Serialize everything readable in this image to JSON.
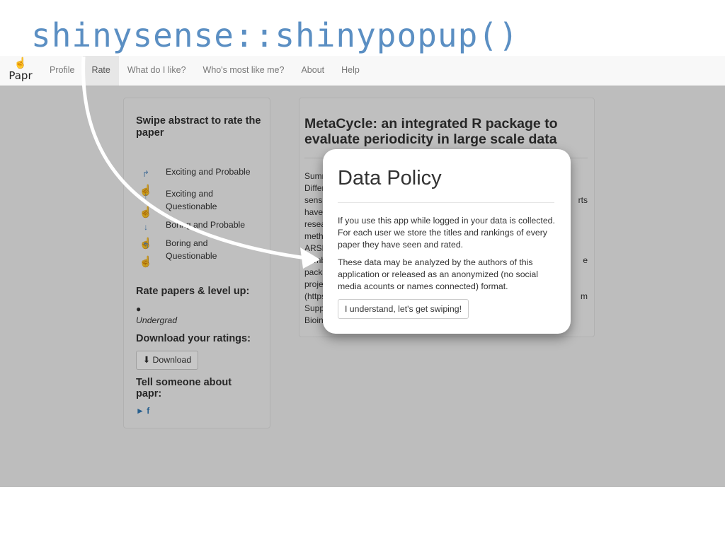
{
  "slide_title": "shinysense::shinypopup()",
  "brand": {
    "icon": "pointing-hand-icon",
    "name": "Papr"
  },
  "nav": {
    "items": [
      {
        "label": "Profile",
        "active": false
      },
      {
        "label": "Rate",
        "active": true
      },
      {
        "label": "What do I like?",
        "active": false
      },
      {
        "label": "Who's most like me?",
        "active": false
      },
      {
        "label": "About",
        "active": false
      },
      {
        "label": "Help",
        "active": false
      }
    ]
  },
  "sidebar": {
    "heading": "Swipe abstract to rate the paper",
    "legend": [
      {
        "icon": "swipe-right-icon",
        "label": "Exciting and Probable"
      },
      {
        "icon": "swipe-up-icon",
        "label": "Exciting and Questionable"
      },
      {
        "icon": "swipe-down-icon",
        "label": "Boring and Probable"
      },
      {
        "icon": "swipe-left-icon",
        "label": "Boring and Questionable"
      }
    ],
    "level_heading": "Rate papers & level up:",
    "level_icon": "user-icon",
    "level": "Undergrad",
    "download_heading": "Download your ratings:",
    "download_button": "Download",
    "tell_heading": "Tell someone about papr:",
    "social_icons": [
      "twitter-icon",
      "facebook-icon"
    ]
  },
  "paper": {
    "title": "MetaCycle: an integrated R package to evaluate periodicity in large scale data",
    "abstract_lines": [
      {
        "left": "Summ",
        "right": ""
      },
      {
        "left": "Differ",
        "right": ""
      },
      {
        "left": "sens",
        "right": "rts"
      },
      {
        "left": "have",
        "right": ""
      },
      {
        "left": "resea",
        "right": ""
      },
      {
        "left": "meth",
        "right": ""
      },
      {
        "left": "ARSE",
        "right": ""
      },
      {
        "left": "Lomb",
        "right": "e"
      },
      {
        "left": "pack",
        "right": ""
      },
      {
        "left": "proje",
        "right": ""
      },
      {
        "left": "(https",
        "right": "m"
      },
      {
        "left": "Supp",
        "right": ""
      },
      {
        "left": "Bioin",
        "right": ""
      }
    ]
  },
  "modal": {
    "title": "Data Policy",
    "paragraph1": "If you use this app while logged in your data is collected. For each user we store the titles and rankings of every paper they have seen and rated.",
    "paragraph2": "These data may be analyzed by the authors of this application or released as an anonymized (no social media acounts or names connected) format.",
    "button": "I understand, let's get swiping!"
  }
}
